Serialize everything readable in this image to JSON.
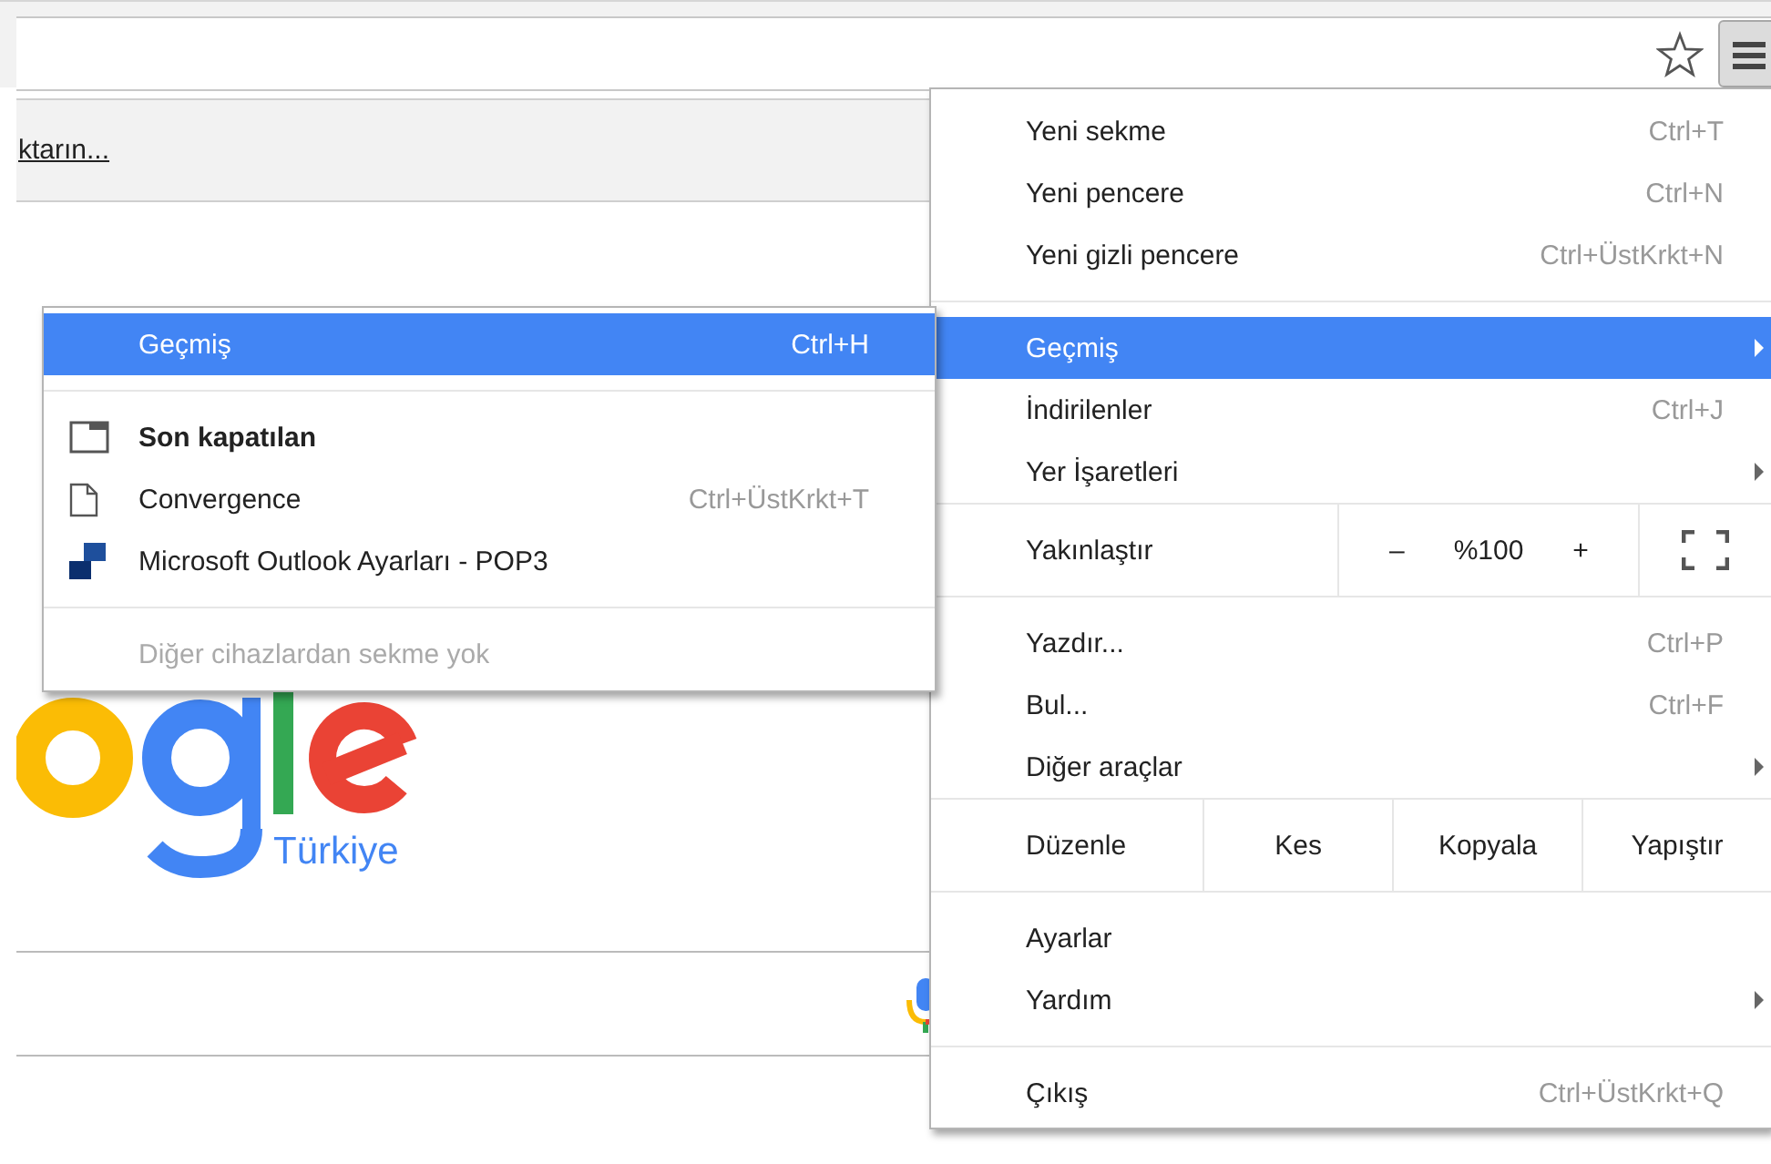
{
  "infobar": {
    "link": "ktarın..."
  },
  "page": {
    "logo_subtitle": "Türkiye"
  },
  "main_menu": {
    "items": [
      {
        "kind": "item",
        "label": "Yeni sekme",
        "shortcut": "Ctrl+T",
        "selected": false,
        "has_submenu": false
      },
      {
        "kind": "item",
        "label": "Yeni pencere",
        "shortcut": "Ctrl+N",
        "selected": false,
        "has_submenu": false
      },
      {
        "kind": "item",
        "label": "Yeni gizli pencere",
        "shortcut": "Ctrl+ÜstKrkt+N",
        "selected": false,
        "has_submenu": false
      },
      {
        "kind": "separator"
      },
      {
        "kind": "item",
        "label": "Geçmiş",
        "selected": true,
        "has_submenu": true
      },
      {
        "kind": "item",
        "label": "İndirilenler",
        "shortcut": "Ctrl+J",
        "selected": false,
        "has_submenu": false
      },
      {
        "kind": "item",
        "label": "Yer İşaretleri",
        "selected": false,
        "has_submenu": true
      },
      {
        "kind": "zoom",
        "label": "Yakınlaştır",
        "minus": "–",
        "value": "%100",
        "plus": "+"
      },
      {
        "kind": "item",
        "label": "Yazdır...",
        "shortcut": "Ctrl+P",
        "selected": false,
        "has_submenu": false
      },
      {
        "kind": "item",
        "label": "Bul...",
        "shortcut": "Ctrl+F",
        "selected": false,
        "has_submenu": false
      },
      {
        "kind": "item",
        "label": "Diğer araçlar",
        "selected": false,
        "has_submenu": true
      },
      {
        "kind": "edit",
        "label": "Düzenle",
        "buttons": [
          "Kes",
          "Kopyala",
          "Yapıştır"
        ]
      },
      {
        "kind": "item",
        "label": "Ayarlar",
        "selected": false,
        "has_submenu": false
      },
      {
        "kind": "item",
        "label": "Yardım",
        "selected": false,
        "has_submenu": true
      },
      {
        "kind": "separator"
      },
      {
        "kind": "item",
        "label": "Çıkış",
        "shortcut": "Ctrl+ÜstKrkt+Q",
        "selected": false,
        "has_submenu": false
      }
    ]
  },
  "history_submenu": {
    "items": [
      {
        "kind": "item",
        "label": "Geçmiş",
        "shortcut": "Ctrl+H",
        "selected": true
      },
      {
        "kind": "separator"
      },
      {
        "kind": "header",
        "label": "Son kapatılan",
        "selected": false
      },
      {
        "kind": "page",
        "label": "Convergence",
        "shortcut": "Ctrl+ÜstKrkt+T",
        "selected": false
      },
      {
        "kind": "site",
        "label": "Microsoft Outlook Ayarları - POP3",
        "selected": false
      },
      {
        "kind": "separator"
      },
      {
        "kind": "note",
        "label": "Diğer cihazlardan sekme yok",
        "disabled": true
      }
    ]
  }
}
